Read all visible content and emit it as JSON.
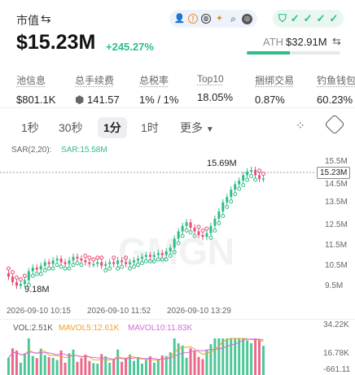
{
  "header": {
    "title": "市值",
    "market_cap": "$15.23M",
    "change": "+245.27%",
    "ath_label": "ATH",
    "ath_value": "$32.91M",
    "ath_progress": 0.46,
    "info_icons": [
      "user-icon",
      "warning-icon",
      "globe-icon",
      "telegram-icon",
      "search-icon",
      "copy-icon"
    ],
    "security_icons": [
      "shield-check-icon",
      "check-icon",
      "check-icon",
      "check-icon",
      "check-icon"
    ]
  },
  "stats": [
    {
      "label": "池信息",
      "value": "$801.1K"
    },
    {
      "label": "总手续费",
      "value": "141.57"
    },
    {
      "label": "总税率",
      "value": "1% / 1%"
    },
    {
      "label": "Top10",
      "value": "18.05%"
    },
    {
      "label": "捆绑交易",
      "value": "0.87%"
    },
    {
      "label": "钓鱼钱包",
      "value": "60.23%"
    }
  ],
  "tabs": [
    {
      "label": "1秒"
    },
    {
      "label": "30秒"
    },
    {
      "label": "1分",
      "active": true
    },
    {
      "label": "1时"
    }
  ],
  "more_label": "更多",
  "indicator": {
    "name": "SAR(2,20):",
    "value": "SAR:15.58M"
  },
  "price_axis": [
    "15.5M",
    "14.5M",
    "13.5M",
    "12.5M",
    "11.5M",
    "10.5M",
    "9.5M"
  ],
  "price_tag": "15.23M",
  "time_axis": [
    "2026-09-10 10:15",
    "2026-09-10 11:52",
    "2026-09-10 13:29"
  ],
  "annotations": {
    "high": "15.69M",
    "low": "9.18M"
  },
  "volume": {
    "vol": "VOL:2.51K",
    "mavol5": "MAVOL5:12.61K",
    "mavol10": "MAVOL10:11.83K",
    "axis": [
      "34.22K",
      "16.78K",
      "-661.11"
    ]
  },
  "colors": {
    "up": "#2ebd85",
    "down": "#e84d73",
    "accent": "#2ebd85"
  },
  "chart_data": {
    "type": "candlestick",
    "indicator": "SAR(2,20)",
    "ylim": [
      9.0,
      16.0
    ],
    "unit": "M",
    "close_series": [
      9.8,
      9.5,
      9.3,
      9.4,
      9.6,
      10.1,
      10.3,
      10.2,
      10.4,
      10.6,
      10.5,
      10.7,
      10.8,
      10.6,
      10.5,
      10.7,
      10.9,
      10.8,
      10.7,
      10.6,
      10.5,
      10.5,
      10.6,
      10.4,
      10.5,
      10.6,
      10.5,
      10.7,
      10.6,
      10.5,
      10.6,
      10.7,
      10.8,
      10.9,
      11.0,
      10.9,
      11.0,
      11.1,
      11.0,
      11.2,
      11.4,
      11.9,
      12.3,
      12.6,
      12.8,
      12.5,
      12.3,
      12.1,
      12.0,
      12.2,
      12.6,
      13.0,
      13.4,
      13.9,
      14.2,
      14.6,
      14.9,
      15.1,
      15.4,
      15.6,
      15.69,
      15.4,
      15.2,
      15.23
    ],
    "volume_max": 34220
  }
}
